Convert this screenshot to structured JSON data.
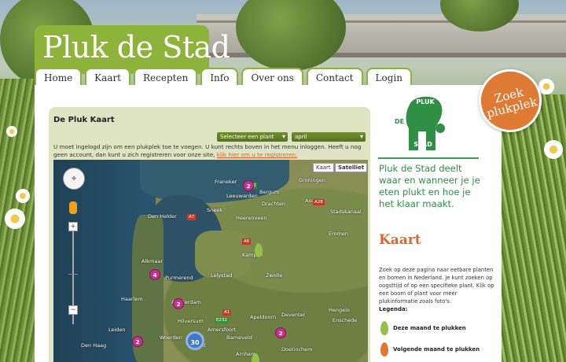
{
  "site": {
    "title": "Pluk de Stad"
  },
  "nav": {
    "items": [
      {
        "label": "Home"
      },
      {
        "label": "Kaart"
      },
      {
        "label": "Recepten"
      },
      {
        "label": "Info"
      },
      {
        "label": "Over ons"
      },
      {
        "label": "Contact"
      },
      {
        "label": "Login"
      }
    ]
  },
  "badge": {
    "line1": "Zoek",
    "line2": "plukplek",
    "color": "#de7a34"
  },
  "map_panel": {
    "title": "De Pluk Kaart",
    "plant_select": "Selecteer een plant",
    "month_select": "april",
    "info_text": "U moet ingelogd zijn om een plukplek toe te voegen. U kunt rechts boven in het menu inloggen. Heeft u nog geen account, dan kunt u zich registreren voor onze site,",
    "register_link": "klik hier om u te registreren.",
    "map_type": {
      "kaart": "Kaart",
      "satelliet": "Satelliet"
    },
    "zoom": {
      "plus": "+",
      "minus": "−"
    },
    "places": [
      "Groningen",
      "Leeuwarden",
      "Franeker",
      "Bergum",
      "Drachten",
      "Heerenveen",
      "Sneek",
      "Emmen",
      "Assen",
      "Stadskanaal",
      "Den Helder",
      "Alkmaar",
      "Purmerend",
      "Amsterdam",
      "Hilversum",
      "Amersfoort",
      "Apeldoorn",
      "Lelystad",
      "Kampen",
      "Zwolle",
      "Deventer",
      "Enschede",
      "Hengelo",
      "Haarlem",
      "Den Haag",
      "Leiden",
      "Woerden",
      "Utrecht",
      "Barneveld",
      "Arnhem",
      "Doetinchem"
    ],
    "clusters": [
      "2",
      "4",
      "2",
      "2",
      "2",
      "30"
    ]
  },
  "brand": {
    "logo_top": "PLUK",
    "logo_left": "DE",
    "logo_bottom": "STAD",
    "color": "#2f8f45"
  },
  "tagline": "Pluk de Stad deelt waar en wanneer je je eten plukt en hoe je het klaar maakt.",
  "section": {
    "title": "Kaart",
    "description": "Zoek op deze pagina naar eetbare planten en bomen in Nederland. Je kunt zoeken op oogsttijd of op een specifieke plant. Klik op een boom of plant voor meer plukinformatie zoals foto's.",
    "legend_title": "Legenda:",
    "legend": [
      {
        "label": "Deze maand te plukken",
        "color": "#94c14a"
      },
      {
        "label": "Volgende maand te plukken",
        "color": "#e07a33"
      }
    ]
  }
}
